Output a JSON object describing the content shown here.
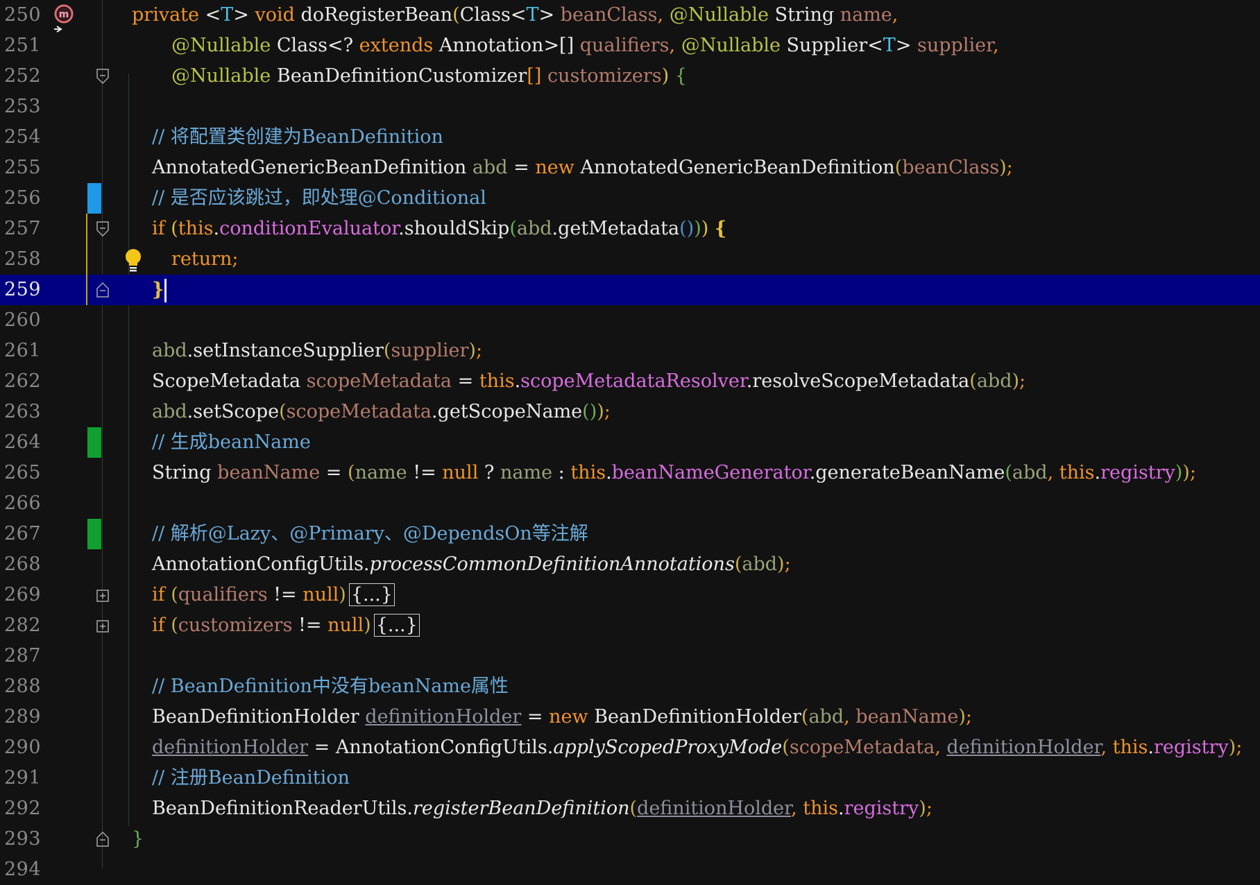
{
  "theme": {
    "background": "#121212",
    "current_line": "#000080",
    "keyword": "#f0932b",
    "comment": "#6aa9d8",
    "field": "#d96de0",
    "change_blue": "#1e9ae8",
    "change_green": "#10a030"
  },
  "gutter": {
    "method_icon": "method-icon",
    "fold_icon": "fold-icon",
    "expand_icon": "expand-fold-icon",
    "bulb_icon": "intention-bulb-icon"
  },
  "lines": {
    "l250": {
      "num": "250",
      "t": [
        "private",
        " <",
        "T",
        "> ",
        "void",
        " doRegisterBean",
        "(",
        "Class",
        "<",
        "T",
        "> ",
        "beanClass",
        ", ",
        "@Nullable",
        " String ",
        "name",
        ","
      ]
    },
    "l251": {
      "num": "251",
      "t": [
        "@Nullable",
        " Class",
        "<? ",
        "extends",
        " Annotation",
        ">[] ",
        "qualifiers",
        ", ",
        "@Nullable",
        " Supplier",
        "<",
        "T",
        "> ",
        "supplier",
        ","
      ]
    },
    "l252": {
      "num": "252",
      "t": [
        "@Nullable",
        " BeanDefinitionCustomizer",
        "[] ",
        "customizers",
        ") ",
        "{"
      ]
    },
    "l253": {
      "num": "253"
    },
    "l254": {
      "num": "254",
      "t": [
        "// 将配置类创建为BeanDefinition"
      ]
    },
    "l255": {
      "num": "255",
      "t": [
        "AnnotatedGenericBeanDefinition ",
        "abd",
        " = ",
        "new",
        " AnnotatedGenericBeanDefinition",
        "(",
        "beanClass",
        ")",
        ";"
      ]
    },
    "l256": {
      "num": "256",
      "t": [
        "// 是否应该跳过，即处理@Conditional"
      ]
    },
    "l257": {
      "num": "257",
      "t": [
        "if",
        " (",
        "this",
        ".",
        "conditionEvaluator",
        ".shouldSkip",
        "(",
        "abd",
        ".getMetadata",
        "()",
        ")",
        ") ",
        "{"
      ]
    },
    "l258": {
      "num": "258",
      "t": [
        "return",
        ";"
      ]
    },
    "l259": {
      "num": "259",
      "t": [
        "}"
      ]
    },
    "l260": {
      "num": "260"
    },
    "l261": {
      "num": "261",
      "t": [
        "abd",
        ".setInstanceSupplier",
        "(",
        "supplier",
        ")",
        ";"
      ]
    },
    "l262": {
      "num": "262",
      "t": [
        "ScopeMetadata ",
        "scopeMetadata",
        " = ",
        "this",
        ".",
        "scopeMetadataResolver",
        ".resolveScopeMetadata",
        "(",
        "abd",
        ")",
        ";"
      ]
    },
    "l263": {
      "num": "263",
      "t": [
        "abd",
        ".setScope",
        "(",
        "scopeMetadata",
        ".getScopeName",
        "()",
        ")",
        ";"
      ]
    },
    "l264": {
      "num": "264",
      "t": [
        "// 生成beanName"
      ]
    },
    "l265": {
      "num": "265",
      "t": [
        "String ",
        "beanName",
        " = ",
        "(",
        "name",
        " != ",
        "null",
        " ? ",
        "name",
        " : ",
        "this",
        ".",
        "beanNameGenerator",
        ".generateBeanName",
        "(",
        "abd",
        ", ",
        "this",
        ".",
        "registry",
        ")",
        ")",
        ";"
      ]
    },
    "l266": {
      "num": "266"
    },
    "l267": {
      "num": "267",
      "t": [
        "// 解析@Lazy、@Primary、@DependsOn等注解"
      ]
    },
    "l268": {
      "num": "268",
      "t": [
        "AnnotationConfigUtils.",
        "processCommonDefinitionAnnotations",
        "(",
        "abd",
        ")",
        ";"
      ]
    },
    "l269": {
      "num": "269",
      "t": [
        "if",
        " (",
        "qualifiers",
        " != ",
        "null",
        ")",
        "{...}"
      ]
    },
    "l282": {
      "num": "282",
      "t": [
        "if",
        " (",
        "customizers",
        " != ",
        "null",
        ")",
        "{...}"
      ]
    },
    "l287": {
      "num": "287"
    },
    "l288": {
      "num": "288",
      "t": [
        "// BeanDefinition中没有beanName属性"
      ]
    },
    "l289": {
      "num": "289",
      "t": [
        "BeanDefinitionHolder ",
        "definitionHolder",
        " = ",
        "new",
        " BeanDefinitionHolder",
        "(",
        "abd",
        ", ",
        "beanName",
        ")",
        ";"
      ]
    },
    "l290": {
      "num": "290",
      "t": [
        "definitionHolder",
        " = AnnotationConfigUtils.",
        "applyScopedProxyMode",
        "(",
        "scopeMetadata",
        ", ",
        "definitionHolder",
        ", ",
        "this",
        ".",
        "registry",
        ")",
        ";"
      ]
    },
    "l291": {
      "num": "291",
      "t": [
        "// 注册BeanDefinition"
      ]
    },
    "l292": {
      "num": "292",
      "t": [
        "BeanDefinitionReaderUtils.",
        "registerBeanDefinition",
        "(",
        "definitionHolder",
        ", ",
        "this",
        ".",
        "registry",
        ")",
        ";"
      ]
    },
    "l293": {
      "num": "293",
      "t": [
        "}"
      ]
    },
    "l294": {
      "num": "294"
    }
  }
}
